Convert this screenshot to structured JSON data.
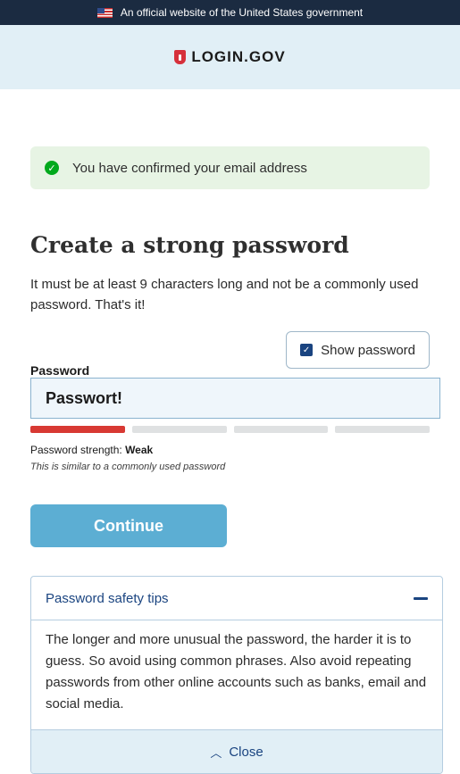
{
  "banner": {
    "text": "An official website of the United States government"
  },
  "logo": {
    "text": "LOGIN.GOV"
  },
  "alert": {
    "message": "You have confirmed your email address"
  },
  "page": {
    "title": "Create a strong password",
    "intro": "It must be at least 9 characters long and not be a commonly used password. That's it!"
  },
  "password": {
    "label": "Password",
    "show_label": "Show password",
    "show_checked": true,
    "value": "Passwort!",
    "strength_prefix": "Password strength: ",
    "strength_value": "Weak",
    "strength_level": 1,
    "strength_max": 4,
    "hint": "This is similar to a commonly used password"
  },
  "continue": {
    "label": "Continue"
  },
  "tips": {
    "title": "Password safety tips",
    "body": "The longer and more unusual the password, the harder it is to guess. So avoid using common phrases. Also avoid repeating passwords from other online accounts such as banks, email and social media.",
    "close_label": "Close"
  },
  "colors": {
    "alert_bg": "#e7f4e4",
    "success": "#00a91c",
    "brand_red": "#d6303b",
    "strength_weak": "#d83933",
    "button": "#5caed3",
    "link": "#1a4480"
  }
}
